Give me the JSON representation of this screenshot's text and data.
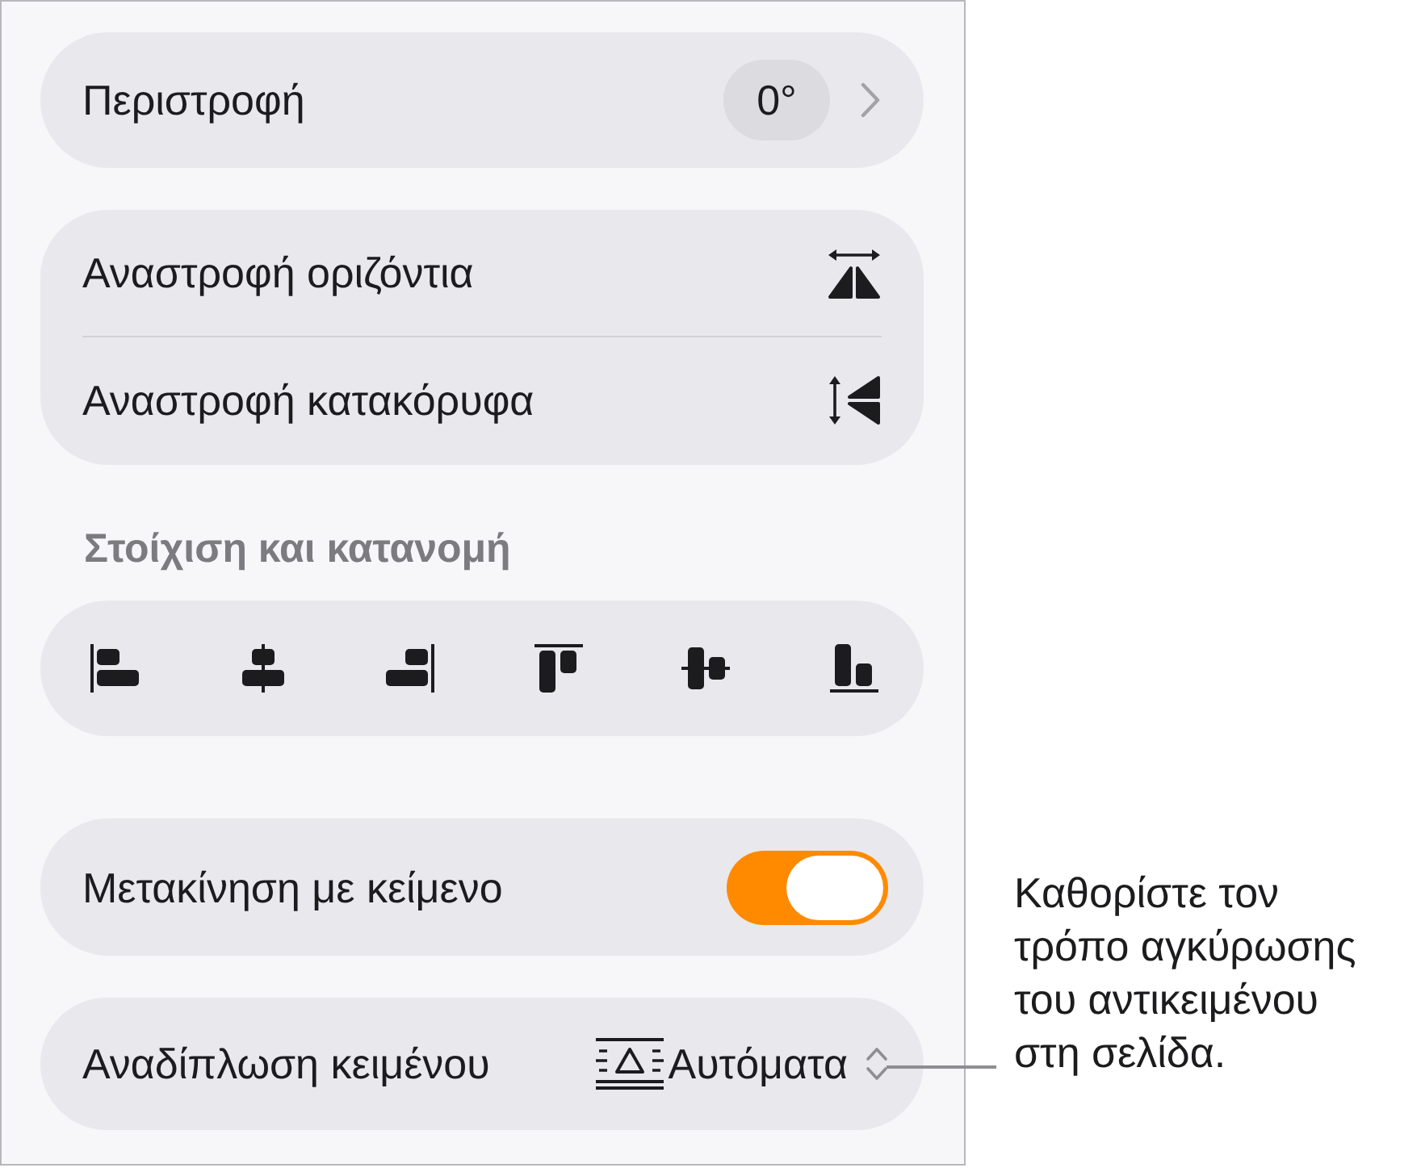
{
  "rotation": {
    "label": "Περιστροφή",
    "value": "0°"
  },
  "flip": [
    {
      "label": "Αναστροφή οριζόντια",
      "kind": "horizontal"
    },
    {
      "label": "Αναστροφή κατακόρυφα",
      "kind": "vertical"
    }
  ],
  "alignment": {
    "title": "Στοίχιση και κατανομή",
    "buttons": [
      {
        "kind": "left"
      },
      {
        "kind": "center"
      },
      {
        "kind": "right"
      },
      {
        "kind": "top"
      },
      {
        "kind": "middle"
      },
      {
        "kind": "bottom"
      }
    ]
  },
  "move_with_text": {
    "label": "Μετακίνηση με κείμενο",
    "on": true
  },
  "text_wrap": {
    "label": "Αναδίπλωση κειμένου",
    "value": "Αυτόματα"
  },
  "callout": {
    "text": "Καθορίστε τον τρόπο αγκύρωσης του αντικειμένου στη σελίδα."
  }
}
